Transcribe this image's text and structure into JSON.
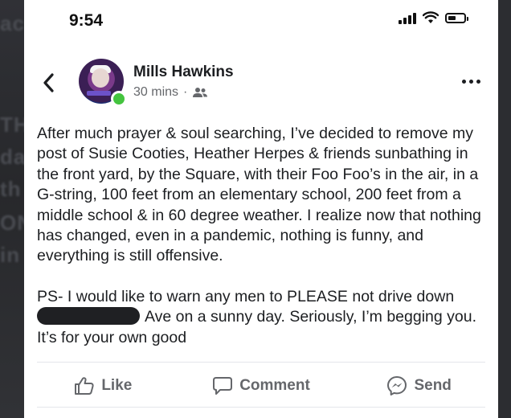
{
  "status_bar": {
    "time": "9:54"
  },
  "post": {
    "author": "Mills Hawkins",
    "meta": "30 mins",
    "separator": "·",
    "paragraph1": "After much prayer & soul searching, I’ve decided to remove my post of Susie Cooties, Heather Herpes & friends sunbathing in the front yard, by the Square, with their Foo Foo’s in the air, in a G-string, 100 feet from an elementary school, 200 feet from a middle school & in 60 degree weather. I realize now that nothing has changed, even in a pandemic, nothing is funny, and everything is still offensive.",
    "paragraph2_line1": "PS- I would like to warn any men to PLEASE not drive down",
    "paragraph2_after_redaction": "Ave on a sunny day. Seriously, I’m begging you. It’s for your own good"
  },
  "actions": {
    "like": "Like",
    "comment": "Comment",
    "send": "Send"
  },
  "background": {
    "ghost_texts": [
      "ac",
      "TH",
      "da",
      "th",
      "ON",
      "in"
    ]
  },
  "colors": {
    "online": "#44c43f",
    "meta_text": "#65676b",
    "body_text": "#1c1e21",
    "backdrop": "#2a2b2f"
  }
}
